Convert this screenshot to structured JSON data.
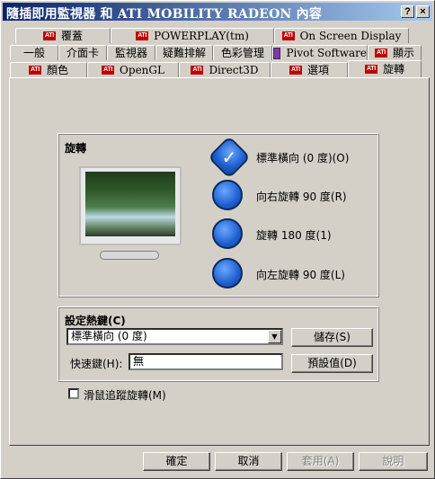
{
  "window": {
    "title": "隨插即用監視器 和 ATI MOBILITY RADEON 內容",
    "help_btn": "?",
    "close_btn": "×"
  },
  "tabs_row1": [
    {
      "label": "覆蓋",
      "icon": "ati-logo-icon"
    },
    {
      "label": "POWERPLAY(tm)",
      "icon": "ati-logo-icon"
    },
    {
      "label": "On Screen Display",
      "icon": "ati-logo-icon"
    }
  ],
  "tabs_row2": [
    {
      "label": "一般"
    },
    {
      "label": "介面卡"
    },
    {
      "label": "監視器"
    },
    {
      "label": "疑難排解"
    },
    {
      "label": "色彩管理"
    },
    {
      "label": "Pivot Software",
      "icon": "pivot-icon"
    },
    {
      "label": "顯示",
      "icon": "ati-logo-icon"
    }
  ],
  "tabs_row3": [
    {
      "label": "顏色",
      "icon": "ati-logo-icon"
    },
    {
      "label": "OpenGL",
      "icon": "ati-logo-icon"
    },
    {
      "label": "Direct3D",
      "icon": "ati-logo-icon"
    },
    {
      "label": "選項",
      "icon": "ati-logo-icon"
    },
    {
      "label": "旋轉",
      "icon": "ati-logo-icon",
      "selected": true
    }
  ],
  "ati_logo_text": "ATI",
  "rotation": {
    "group_label": "旋轉",
    "options": [
      {
        "label": "標準橫向 (0 度)(O)",
        "checked": true
      },
      {
        "label": "向右旋轉 90 度(R)",
        "checked": false
      },
      {
        "label": "旋轉 180 度(1)",
        "checked": false
      },
      {
        "label": "向左旋轉 90 度(L)",
        "checked": false
      }
    ],
    "check_glyph": "✓"
  },
  "hotkeys": {
    "group_label": "設定熱鍵(C)",
    "dropdown_value": "標準橫向 (0 度)",
    "dropdown_arrow": "▼",
    "shortcut_label": "快速鍵(H):",
    "shortcut_value": "無",
    "save_button": "儲存(S)",
    "default_button": "預設值(D)"
  },
  "mouse_tracking": {
    "label": "滑鼠追蹤旋轉(M)",
    "checked": false
  },
  "footer": {
    "ok": "確定",
    "cancel": "取消",
    "apply": "套用(A)",
    "help": "說明"
  }
}
